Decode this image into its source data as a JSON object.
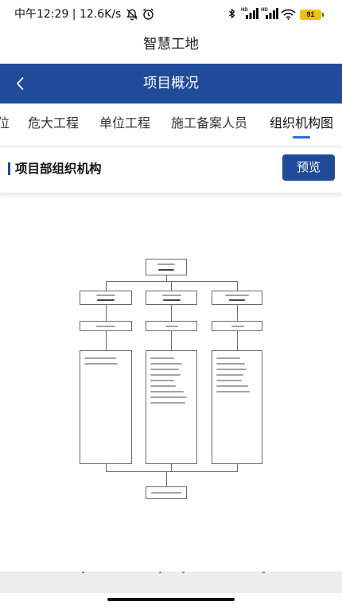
{
  "status_bar": {
    "time_and_speed": "中午12:29 | 12.6K/s",
    "icons": {
      "mute": "mute-icon",
      "alarm": "alarm-icon",
      "bluetooth": "bluetooth-icon",
      "signal_1": "signal-icon",
      "signal_2": "signal-icon",
      "wifi": "wifi-icon",
      "battery": "battery-icon"
    },
    "signal_1_label": "HD",
    "signal_2_label": "HD",
    "battery_level": "91"
  },
  "app_title": "智慧工地",
  "header": {
    "back_icon": "chevron-left-icon",
    "title": "项目概况"
  },
  "tabs": [
    {
      "label": "位",
      "active": false
    },
    {
      "label": "危大工程",
      "active": false
    },
    {
      "label": "单位工程",
      "active": false
    },
    {
      "label": "施工备案人员",
      "active": false
    },
    {
      "label": "组织机构图",
      "active": true
    }
  ],
  "section": {
    "title": "项目部组织机构",
    "preview_button": "预览"
  },
  "colors": {
    "primary": "#1f4b98",
    "tab_indicator": "#2e6fd8",
    "battery_fill": "#f2c200",
    "page_background": "#f3f4f6"
  }
}
